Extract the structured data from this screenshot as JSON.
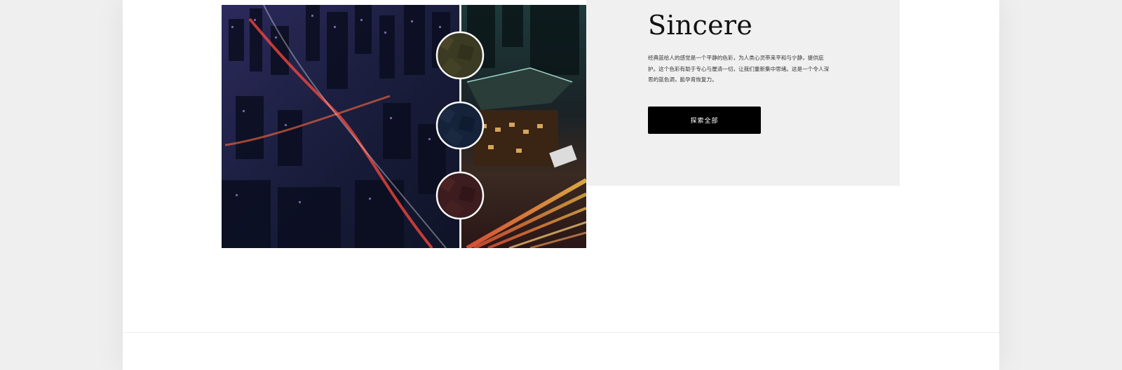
{
  "feature": {
    "title": "Sincere",
    "description": "经典蓝给人的感觉是一个平静的色彩，为人类心灵带来平和与宁静，提供庇护。这个色彩有助于专心与厘清一切，让我们重新集中思绪。这是一个令人深思的蓝色调，能孕育恢复力。",
    "button_label": "探索全部"
  },
  "image": {
    "left_scene": "city-night-aerial",
    "right_scene": "city-traffic-light-trails",
    "swatch_colors": [
      "#3b3a22",
      "#14223a",
      "#3c1c1e"
    ]
  }
}
